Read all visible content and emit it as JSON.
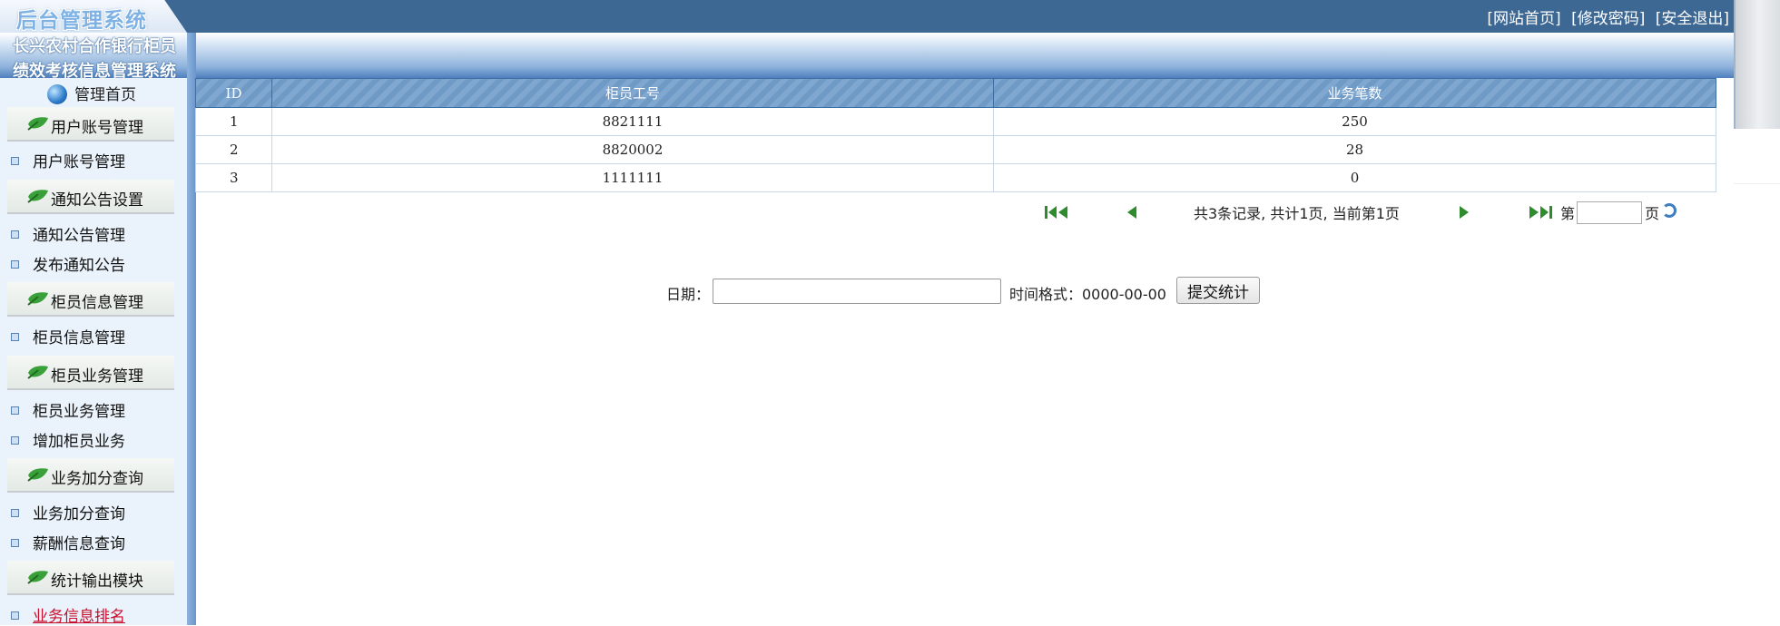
{
  "topbar": {
    "logo": "后台管理系统",
    "links": [
      "[网站首页]",
      "[修改密码]",
      "[安全退出]"
    ]
  },
  "system_title": [
    "长兴农村合作银行柜员",
    "绩效考核信息管理系统"
  ],
  "sidebar": {
    "home": "管理首页",
    "sections": [
      {
        "title": "用户账号管理",
        "items": [
          "用户账号管理"
        ]
      },
      {
        "title": "通知公告设置",
        "items": [
          "通知公告管理",
          "发布通知公告"
        ]
      },
      {
        "title": "柜员信息管理",
        "items": [
          "柜员信息管理"
        ]
      },
      {
        "title": "柜员业务管理",
        "items": [
          "柜员业务管理",
          "增加柜员业务"
        ]
      },
      {
        "title": "业务加分查询",
        "items": [
          "业务加分查询",
          "薪酬信息查询"
        ]
      },
      {
        "title": "统计输出模块",
        "items": [
          "业务信息排名"
        ]
      }
    ],
    "active_item": "业务信息排名"
  },
  "table": {
    "headers": [
      "ID",
      "柜员工号",
      "业务笔数"
    ],
    "rows": [
      [
        "1",
        "8821111",
        "250"
      ],
      [
        "2",
        "8820002",
        "28"
      ],
      [
        "3",
        "1111111",
        "0"
      ]
    ]
  },
  "pager": {
    "summary": "共3条记录, 共计1页, 当前第1页",
    "page_prefix": "第",
    "page_suffix": "页",
    "page_value": ""
  },
  "form": {
    "date_label": "日期：",
    "date_value": "",
    "format_hint": "时间格式：0000-00-00",
    "submit_label": "提交统计"
  },
  "colors": {
    "topbar": "#3e6894",
    "header_accent": "#4f7fbd",
    "table_header": "#7fa7d0",
    "sidebar_bg": "#eaf2fb",
    "leaf_icon": "#3aa03a",
    "pager_icon": "#2e8b2e",
    "active_link": "#c8102e"
  },
  "icons": [
    "globe-icon",
    "leaf-icon",
    "first-page-icon",
    "prev-page-icon",
    "next-page-icon",
    "last-page-icon",
    "refresh-icon"
  ]
}
